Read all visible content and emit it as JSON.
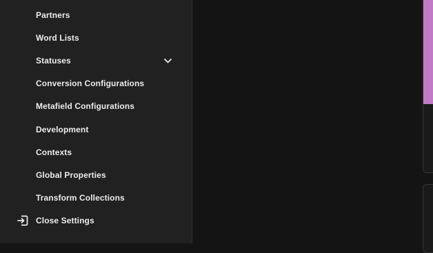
{
  "sidebar": {
    "items": [
      {
        "label": "Partners"
      },
      {
        "label": "Word Lists"
      },
      {
        "label": "Statuses",
        "icon": "chevron-down-icon"
      },
      {
        "label": "Conversion Configurations"
      },
      {
        "label": "Metafield Configurations"
      },
      {
        "label": "Development"
      },
      {
        "label": "Contexts"
      },
      {
        "label": "Global Properties"
      },
      {
        "label": "Transform Collections"
      }
    ],
    "close_settings": {
      "label": "Close Settings",
      "icon": "exit-icon"
    }
  },
  "colors": {
    "background": "#141414",
    "sidebar_background": "#212121",
    "text": "#ececec",
    "accent": "#c07ac6"
  }
}
